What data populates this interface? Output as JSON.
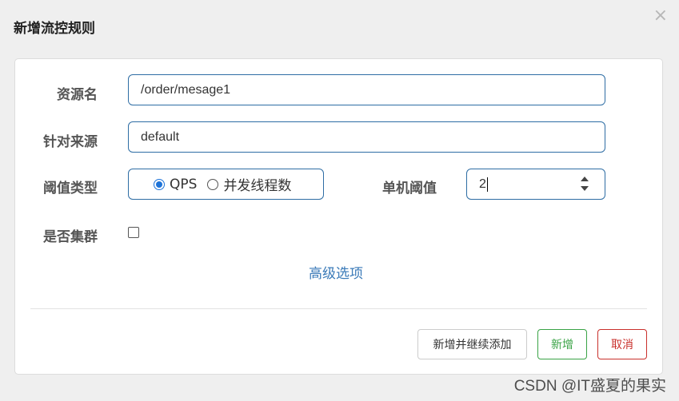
{
  "dialog": {
    "title": "新增流控规则",
    "close_symbol": "×"
  },
  "form": {
    "resource": {
      "label": "资源名",
      "value": "/order/mesage1"
    },
    "origin": {
      "label": "针对来源",
      "value": "default"
    },
    "threshold_type": {
      "label": "阈值类型",
      "options": [
        {
          "label": "QPS",
          "checked": true
        },
        {
          "label": "并发线程数",
          "checked": false
        }
      ]
    },
    "single_threshold": {
      "label": "单机阈值",
      "value": "2"
    },
    "cluster": {
      "label": "是否集群",
      "checked": false
    },
    "advanced_link": "高级选项"
  },
  "footer": {
    "add_continue_label": "新增并继续添加",
    "add_label": "新增",
    "cancel_label": "取消"
  },
  "watermark": "CSDN @IT盛夏的果实",
  "colors": {
    "input_border": "#2e6da4",
    "link": "#3a7ab8",
    "success": "#3aa346",
    "danger": "#c9302c",
    "radio_checked": "#1e73d8"
  }
}
